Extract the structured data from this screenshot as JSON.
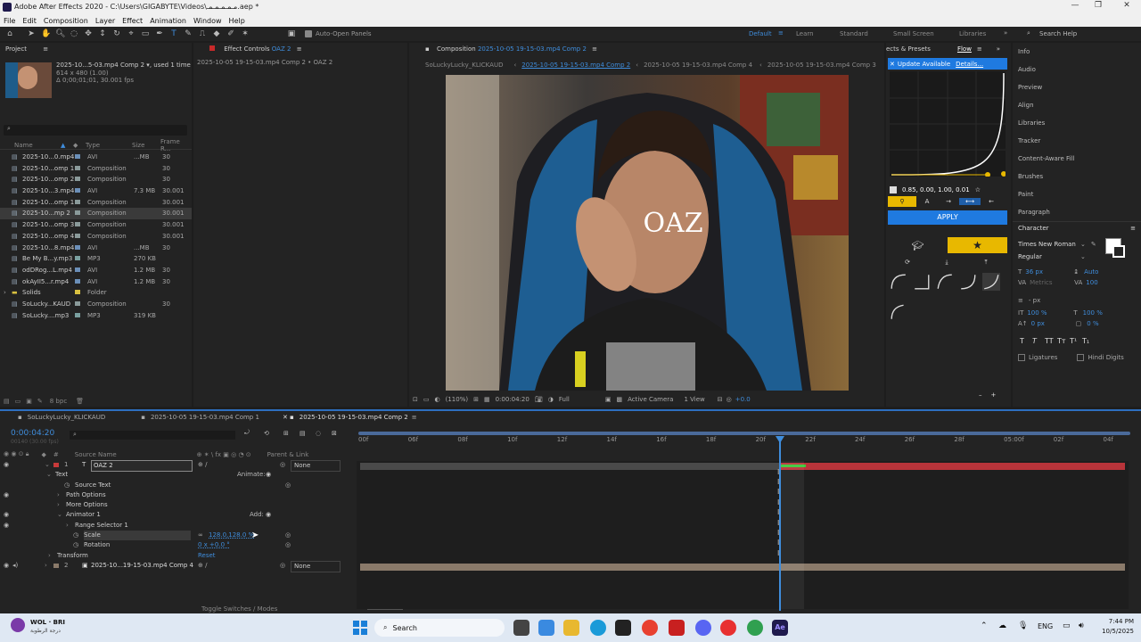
{
  "window": {
    "title": "Adobe After Effects 2020 - C:\\Users\\GIGABYTE\\Videos\\مـمـمـمـمـ.aep *",
    "controls": [
      "—",
      "❐",
      "✕"
    ]
  },
  "menu": [
    "File",
    "Edit",
    "Composition",
    "Layer",
    "Effect",
    "Animation",
    "Window",
    "Help"
  ],
  "toolbar": {
    "auto_open": "Auto-Open Panels",
    "workspaces": [
      "Default",
      "Learn",
      "Standard",
      "Small Screen",
      "Libraries"
    ],
    "search": "Search Help"
  },
  "project": {
    "tab": "Project",
    "item_name": "2025-10...5-03.mp4 Comp 2 ▾",
    "used": ", used 1 time",
    "dims": "614 x 480 (1.00)",
    "duration": "Δ 0;00;01;01, 30.001 fps",
    "headers": {
      "name": "Name",
      "type": "Type",
      "size": "Size",
      "fr": "Frame R..."
    },
    "items": [
      {
        "name": "2025-10...0.mp4",
        "type": "AVI",
        "size": "...MB",
        "fr": "30",
        "color": "#6b8fb8"
      },
      {
        "name": "2025-10...omp 1",
        "type": "Composition",
        "size": "",
        "fr": "30",
        "color": "#8a9a9a"
      },
      {
        "name": "2025-10...omp 2",
        "type": "Composition",
        "size": "",
        "fr": "30",
        "color": "#8a9a9a"
      },
      {
        "name": "2025-10...3.mp4",
        "type": "AVI",
        "size": "7.3 MB",
        "fr": "30.001",
        "color": "#6b8fb8"
      },
      {
        "name": "2025-10...omp 1",
        "type": "Composition",
        "size": "",
        "fr": "30.001",
        "color": "#8a9a9a"
      },
      {
        "name": "2025-10...mp 2",
        "type": "Composition",
        "size": "",
        "fr": "30.001",
        "color": "#8a9a9a",
        "sel": true
      },
      {
        "name": "2025-10...omp 3",
        "type": "Composition",
        "size": "",
        "fr": "30.001",
        "color": "#8a9a9a"
      },
      {
        "name": "2025-10...omp 4",
        "type": "Composition",
        "size": "",
        "fr": "30.001",
        "color": "#8a9a9a"
      },
      {
        "name": "2025-10...8.mp4",
        "type": "AVI",
        "size": "...MB",
        "fr": "30",
        "color": "#6b8fb8"
      },
      {
        "name": "Be My B...y.mp3",
        "type": "MP3",
        "size": "270 KB",
        "fr": "",
        "color": "#7aa0a0"
      },
      {
        "name": "odDRog...L.mp4",
        "type": "AVI",
        "size": "1.2 MB",
        "fr": "30",
        "color": "#6b8fb8"
      },
      {
        "name": "okAyII5...r.mp4",
        "type": "AVI",
        "size": "1.2 MB",
        "fr": "30",
        "color": "#6b8fb8"
      },
      {
        "name": "Solids",
        "type": "Folder",
        "size": "",
        "fr": "",
        "color": "#d8c040"
      },
      {
        "name": "SoLucky...KAUD",
        "type": "Composition",
        "size": "",
        "fr": "30",
        "color": "#8a9a9a"
      },
      {
        "name": "SoLucky....mp3",
        "type": "MP3",
        "size": "319 KB",
        "fr": "",
        "color": "#7aa0a0"
      }
    ],
    "bpc": "8 bpc"
  },
  "effect_controls": {
    "tab": "Effect Controls",
    "tab_suffix": "OAZ 2",
    "subtitle": "2025-10-05 19-15-03.mp4 Comp 2 • OAZ 2"
  },
  "composition": {
    "tab": "Composition",
    "tab_suffix": "2025-10-05 19-15-03.mp4 Comp 2",
    "subtabs": [
      "SoLuckyLucky_KLICKAUD",
      "2025-10-05 19-15-03.mp4 Comp 2",
      "2025-10-05 19-15-03.mp4 Comp 4",
      "2025-10-05 19-15-03.mp4 Comp 3"
    ],
    "overlay_text": "OAZ",
    "footer": {
      "zoom": "(110%)",
      "time": "0:00:04:20",
      "quality": "Full",
      "camera": "Active Camera",
      "view": "1 View",
      "offset": "+0.0"
    }
  },
  "flow": {
    "tabs": [
      "ects & Presets",
      "Flow"
    ],
    "banner": "Update Available",
    "banner_link": "Details...",
    "bezier": "0.85, 0.00, 1.00, 0.01",
    "apply": "APPLY"
  },
  "right_panels": [
    "Info",
    "Audio",
    "Preview",
    "Align",
    "Libraries",
    "Tracker",
    "Content-Aware Fill",
    "Brushes",
    "Paint",
    "Paragraph",
    "Character"
  ],
  "character": {
    "font": "Times New Roman",
    "style": "Regular",
    "size": "36 px",
    "leading": "Auto",
    "kerning": "Metrics",
    "tracking": "100",
    "stroke": "- px",
    "vscale": "100 %",
    "hscale": "100 %",
    "baseline": "0 px",
    "tsume": "0 %",
    "ligatures": "Ligatures",
    "hindi": "Hindi Digits"
  },
  "timeline": {
    "tabs": [
      "SoLuckyLucky_KLICKAUD",
      "2025-10-05 19-15-03.mp4 Comp 1",
      "2025-10-05 19-15-03.mp4 Comp 2"
    ],
    "time": "0:00:04:20",
    "time_sub": "00140 (30.00 fps)",
    "col_source": "Source Name",
    "col_parent": "Parent & Link",
    "ruler": [
      "00f",
      "06f",
      "08f",
      "10f",
      "12f",
      "14f",
      "16f",
      "18f",
      "20f",
      "22f",
      "24f",
      "26f",
      "28f",
      "05:00f",
      "02f",
      "04f"
    ],
    "layers": [
      {
        "num": "1",
        "name": "OAZ 2",
        "parent": "None"
      },
      {
        "prop": "Text",
        "animate": "Animate:"
      },
      {
        "prop": "Source Text"
      },
      {
        "prop": "Path Options"
      },
      {
        "prop": "More Options"
      },
      {
        "prop": "Animator 1",
        "add": "Add:"
      },
      {
        "prop": "Range Selector 1"
      },
      {
        "prop": "Scale",
        "value": "128.0,128.0 %"
      },
      {
        "prop": "Rotation",
        "value": "0 x +0.0 °"
      },
      {
        "prop": "Transform",
        "reset": "Reset"
      },
      {
        "num": "2",
        "name": "2025-10...19-15-03.mp4 Comp 4",
        "parent": "None"
      }
    ],
    "toggle": "Toggle Switches / Modes"
  },
  "taskbar": {
    "weather": "WOL · BRI",
    "weather_sub": "درجة الرطوبة",
    "search": "Search",
    "lang": "ENG",
    "time": "7:44 PM",
    "date": "10/5/2025"
  }
}
